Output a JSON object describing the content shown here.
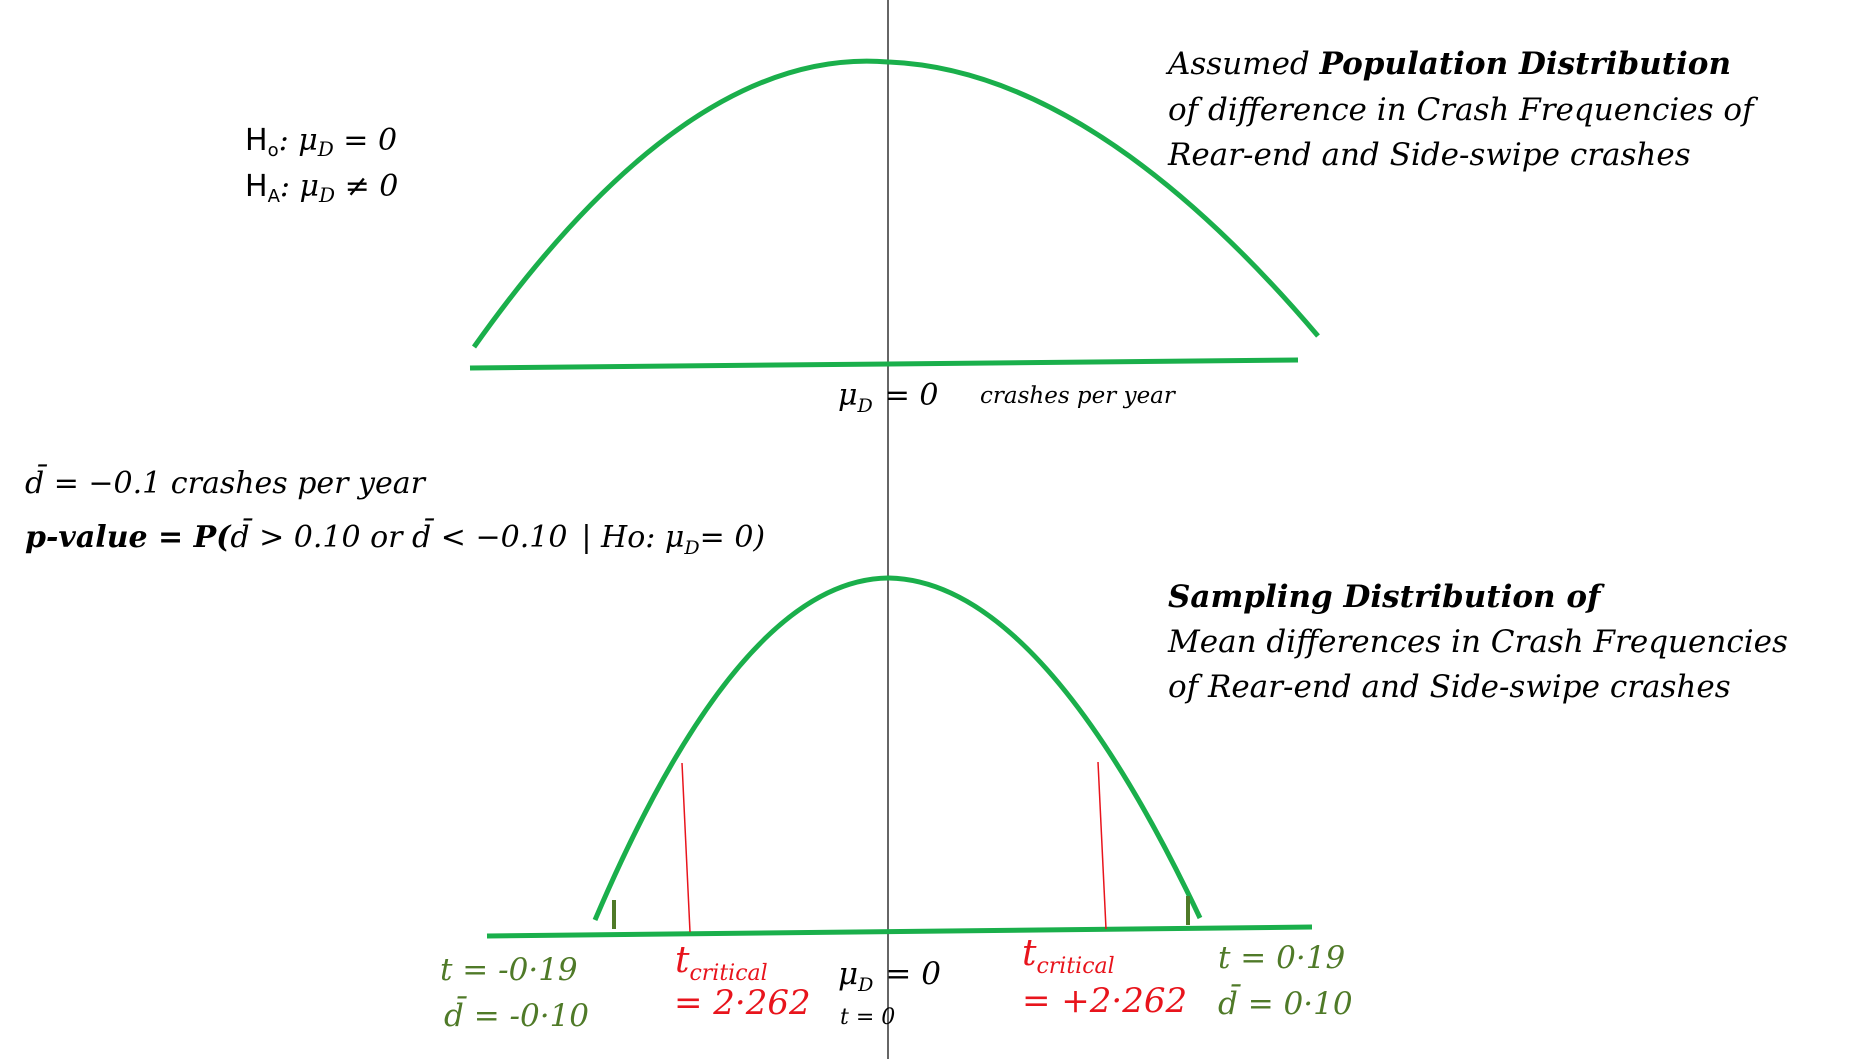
{
  "colors": {
    "curve": "#1aaf4b",
    "axis": "#1aaf4b",
    "mean_line": "#333333",
    "critical": "#e8141c",
    "observed": "#4f7a28",
    "text": "#000000"
  },
  "hypotheses": {
    "h0_prefix": "H",
    "h0_sub": "o",
    "h0_rest": ":  μ",
    "h0_mu_sub": "D",
    "h0_eq": "  =  0",
    "ha_prefix": "H",
    "ha_sub": "A",
    "ha_rest": ":  μ",
    "ha_mu_sub": "D",
    "ha_eq": "  ≠  0"
  },
  "population": {
    "title_l1_a": "Assumed ",
    "title_l1_b": "Population Distribution",
    "title_l2": "of difference in Crash Frequencies of",
    "title_l3": "Rear-end and Side-swipe crashes",
    "mu": "μ",
    "mu_sub": "D",
    "eq": "=  0",
    "unit": "crashes per year"
  },
  "stats": {
    "dbar_line": "d̄ = −0.1  crashes per year",
    "pvalue_a": "p-value  =  P(",
    "pvalue_b": "d̄ > 0.10 or d̄  < −0.10",
    "pvalue_c": "| Ho: μ",
    "pvalue_sub": "D",
    "pvalue_d": "= 0)"
  },
  "sampling": {
    "title_l1": "Sampling Distribution of",
    "title_l2": "Mean differences in Crash Frequencies",
    "title_l3": "of Rear-end and Side-swipe crashes",
    "mu": "μ",
    "mu_sub": "D",
    "eq": "=  0",
    "t_zero": "t = 0",
    "left_t": "t = -0·19",
    "left_d": "d̄  =  -0·10",
    "right_t": "t = 0·19",
    "right_d": "d̄  =  0·10",
    "tcrit_t": "t",
    "tcrit_sub": "critical",
    "left_crit_val": "=  2·262",
    "right_crit_val": "= +2·262"
  }
}
